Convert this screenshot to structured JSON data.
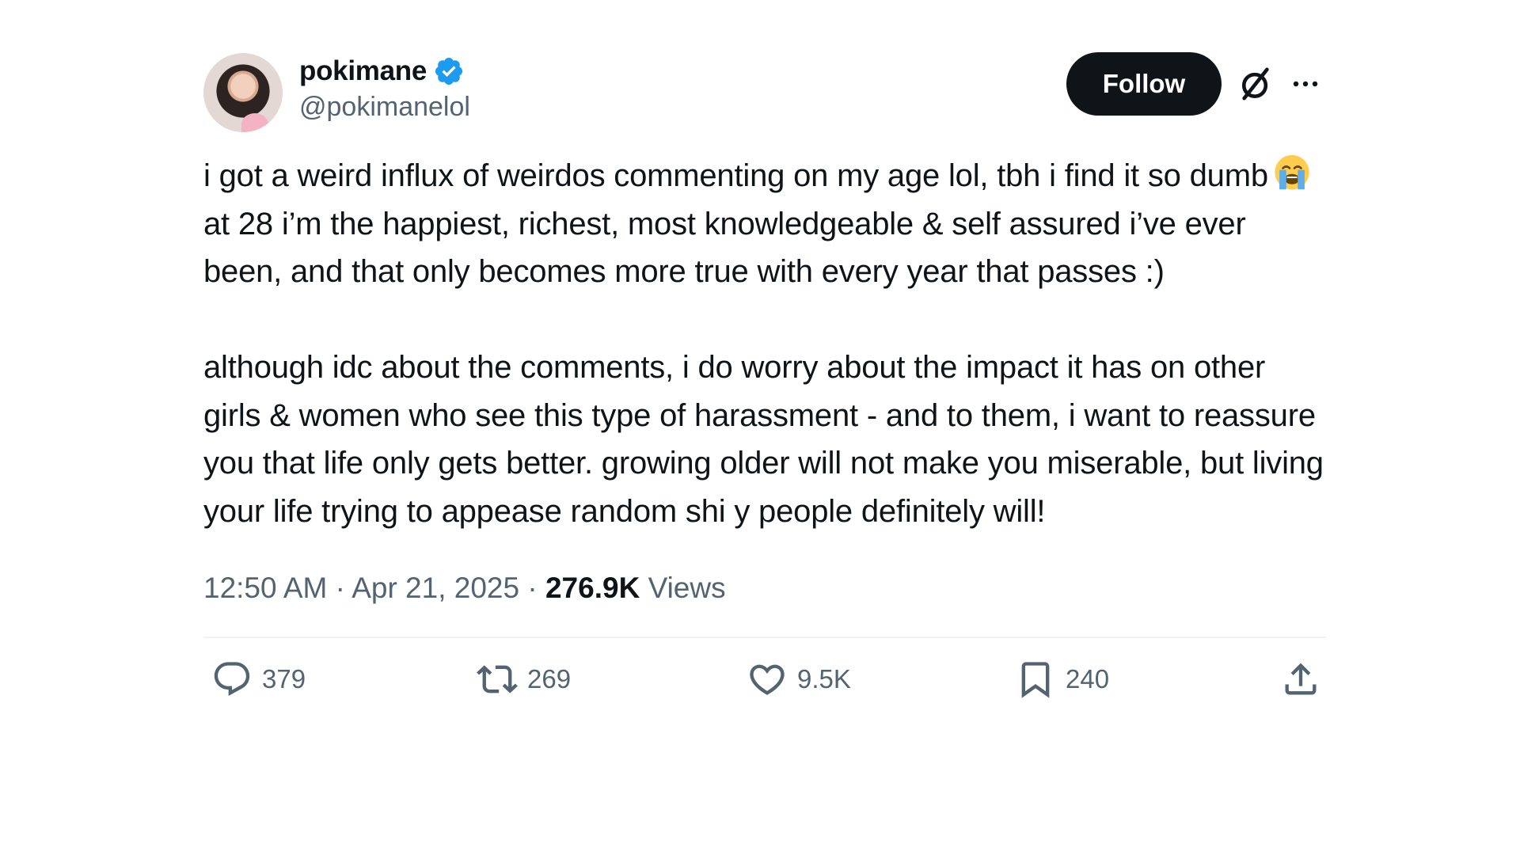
{
  "author": {
    "display_name": "pokimane",
    "handle": "@pokimanelol"
  },
  "header": {
    "follow_label": "Follow"
  },
  "tweet": {
    "paragraph1": {
      "before_emoji": "i got a weird influx of weirdos commenting on my age lol, tbh i find it so dumb",
      "emoji": "loudly-crying-face",
      "after_emoji": "at 28 i’m the happiest, richest, most knowledgeable & self assured i’ve ever been, and that only becomes more true with every year that passes :)"
    },
    "paragraph2": "although idc about the comments, i do worry about the impact it has on other girls & women who see this type of harassment - and to them, i want to reassure you that life only gets better. growing older will not make you miserable, but living your life trying to appease random shi   y people definitely will!"
  },
  "meta": {
    "time": "12:50 AM",
    "separator": "·",
    "date": "Apr 21, 2025",
    "views_count": "276.9K",
    "views_label": "Views"
  },
  "actions": {
    "replies": "379",
    "reposts": "269",
    "likes": "9.5K",
    "bookmarks": "240"
  },
  "colors": {
    "text": "#0f1419",
    "secondary": "#536471",
    "verified": "#1d9bf0",
    "follow_bg": "#0f1419"
  }
}
